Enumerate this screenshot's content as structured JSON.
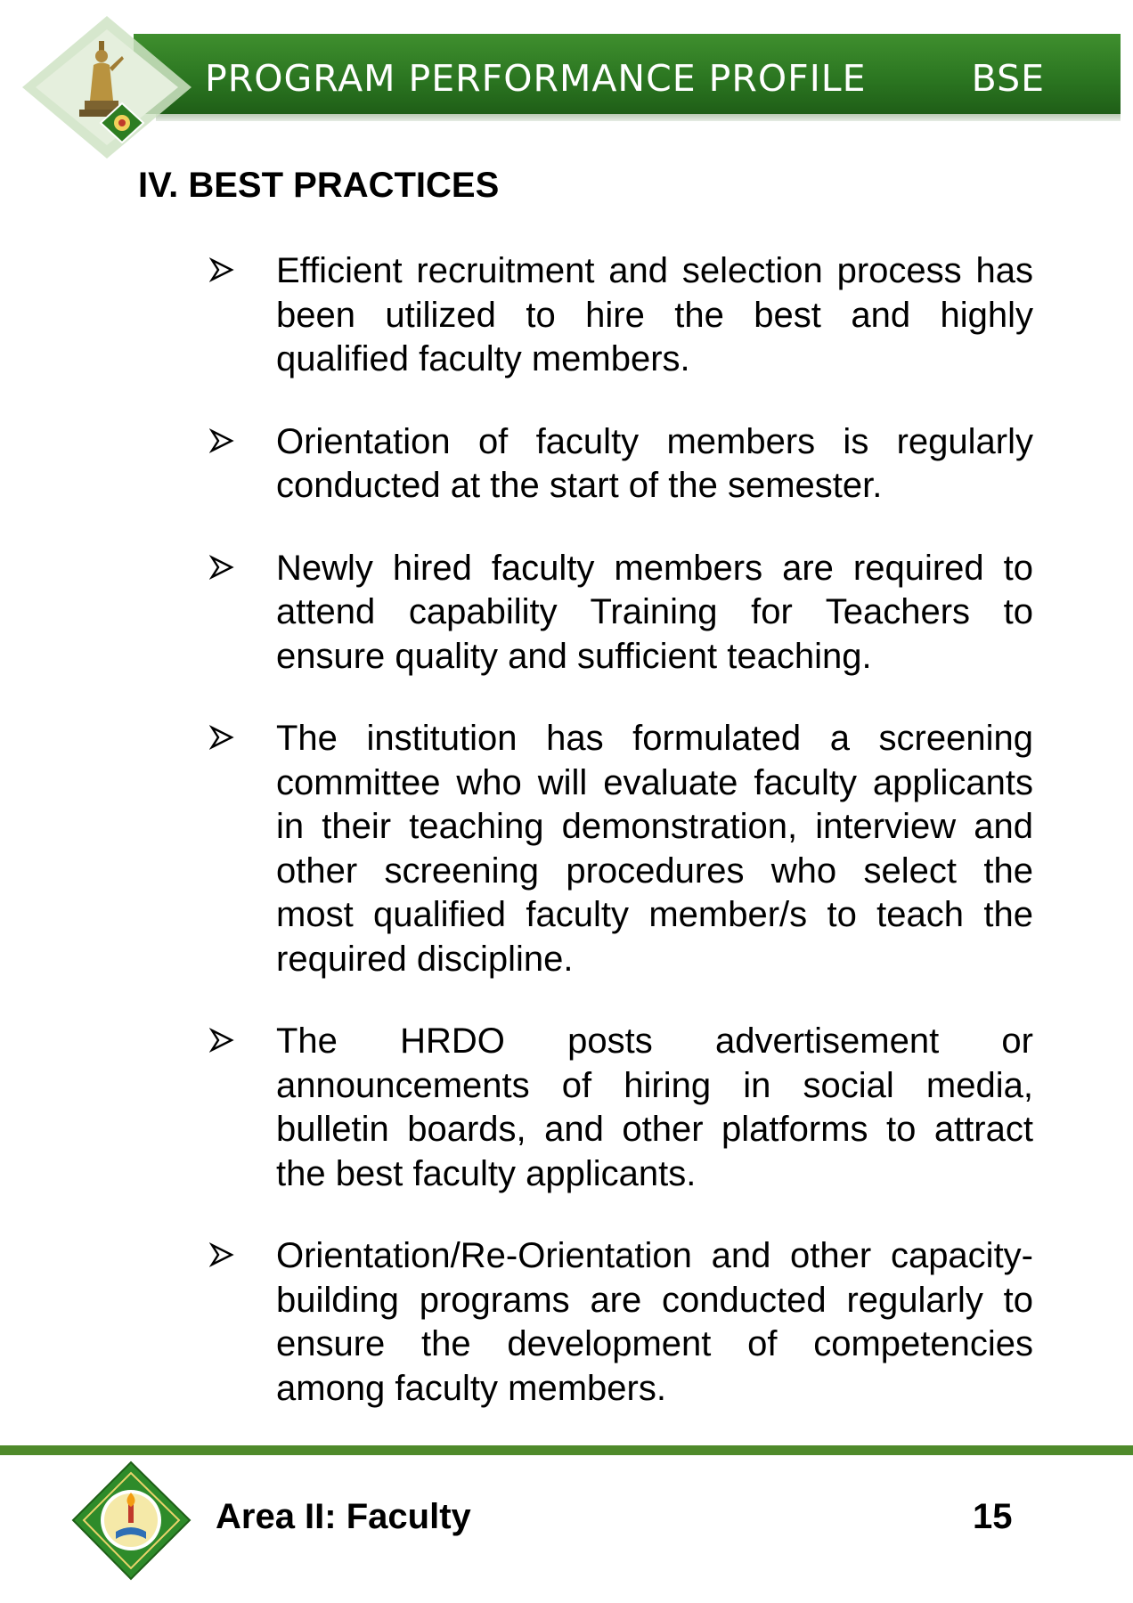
{
  "header": {
    "title": "PROGRAM PERFORMANCE PROFILE",
    "program_code": "BSE",
    "colors": {
      "banner": "#2a7420",
      "accent_gold": "#c9a34a"
    },
    "emblem_icon": "statue-emblem-icon"
  },
  "section": {
    "heading": "IV.  BEST PRACTICES"
  },
  "practices": [
    {
      "text": "Efficient recruitment and selection process has been utilized to hire the best and highly qualified faculty members."
    },
    {
      "text": "Orientation of faculty members is regularly conducted at the start of the semester."
    },
    {
      "text": "Newly hired faculty members are required to attend capability Training for Teachers to ensure quality and sufficient teaching."
    },
    {
      "text": "The institution has formulated a screening committee who will evaluate faculty applicants in their teaching demonstration, interview and other screening procedures who select the most qualified faculty member/s to teach the required discipline."
    },
    {
      "text": "The HRDO posts advertisement or announcements of hiring in social media, bulletin boards, and other platforms to attract the best faculty applicants."
    },
    {
      "text": "Orientation/Re-Orientation and other capacity-building programs are conducted regularly to ensure the development of competencies among faculty members."
    }
  ],
  "bullet_icon": "arrow-bullet-icon",
  "footer": {
    "area_label": "Area II: Faculty",
    "page_number": "15",
    "seal_icon": "university-seal-icon",
    "rule_color": "#4f8a2b"
  }
}
